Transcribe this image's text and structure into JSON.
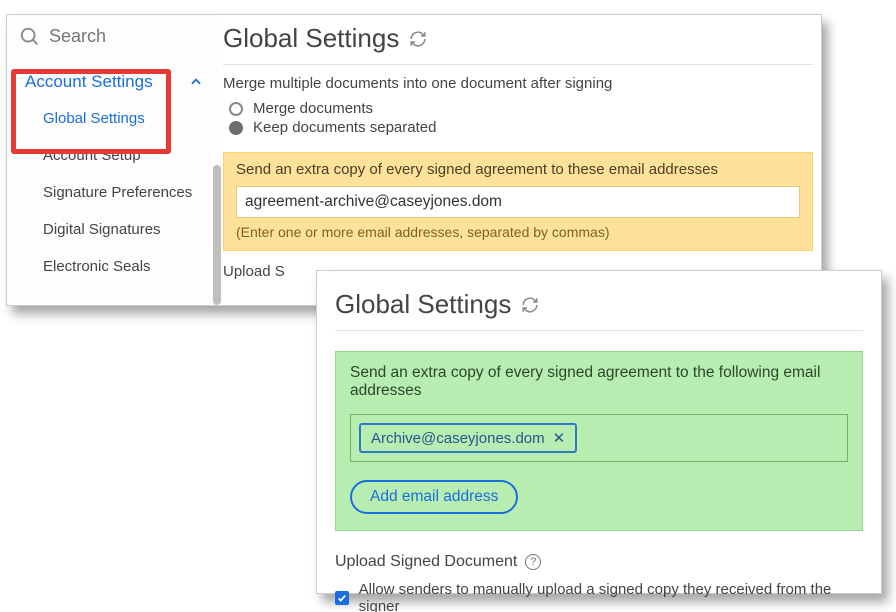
{
  "sidebar": {
    "search_placeholder": "Search",
    "section_label": "Account Settings",
    "items": [
      {
        "label": "Global Settings",
        "active": true
      },
      {
        "label": "Account Setup"
      },
      {
        "label": "Signature Preferences"
      },
      {
        "label": "Digital Signatures"
      },
      {
        "label": "Electronic Seals"
      }
    ]
  },
  "panel1": {
    "title": "Global Settings",
    "merge_heading": "Merge multiple documents into one document after signing",
    "merge_options": {
      "merge": "Merge documents",
      "keep": "Keep documents separated"
    },
    "carbon": {
      "title": "Send an extra copy of every signed agreement to these email addresses",
      "value": "agreement-archive@caseyjones.dom",
      "hint": "(Enter one or more email addresses, separated by commas)"
    },
    "upload_fragment": "Upload S"
  },
  "panel2": {
    "title": "Global Settings",
    "carbon": {
      "title": "Send an extra copy of every signed agreement to the following email addresses",
      "chip": "Archive@caseyjones.dom",
      "add_button": "Add email address"
    },
    "upload": {
      "label": "Upload Signed Document",
      "allow_label": "Allow senders to manually upload a signed copy they received from the signer"
    }
  }
}
